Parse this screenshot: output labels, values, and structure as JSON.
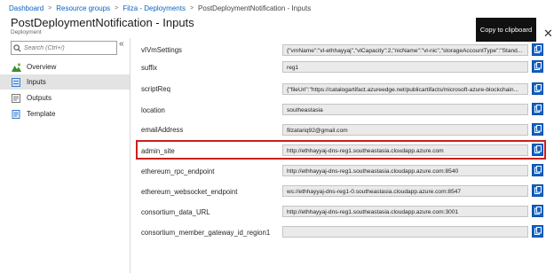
{
  "breadcrumb": [
    "Dashboard",
    "Resource groups",
    "Filza - Deployments",
    "PostDeploymentNotification - Inputs"
  ],
  "breadcrumb_separator": ">",
  "title": "PostDeploymentNotification - Inputs",
  "subtitle": "Deployment",
  "tooltip": "Copy to clipboard",
  "close_glyph": "✕",
  "search": {
    "placeholder": "Search (Ctrl+/)"
  },
  "collapse_glyph": "«",
  "nav": [
    {
      "label": "Overview",
      "icon": "overview-icon"
    },
    {
      "label": "Inputs",
      "icon": "inputs-icon",
      "active": true
    },
    {
      "label": "Outputs",
      "icon": "outputs-icon"
    },
    {
      "label": "Template",
      "icon": "template-icon"
    }
  ],
  "rows": [
    {
      "label": "vIVmSettings",
      "value": "{\"vmName\":\"vl-ethhayyaj\",\"vlCapacity\":2,\"nicName\":\"vl-nic\",\"storageAccountType\":\"Stand..."
    },
    {
      "label": "suffix",
      "value": "reg1"
    },
    {
      "label": "scriptReq",
      "value": "{\"fileUri\":\"https://catalogartifact.azureedge.net/publicartifacts/microsoft-azure-blockchain..."
    },
    {
      "label": "location",
      "value": "southeastasia"
    },
    {
      "label": "emailAddress",
      "value": "filzatariq92@gmail.com"
    },
    {
      "label": "admin_site",
      "value": "http://ethhayyaj-dns-reg1.southeastasia.cloudapp.azure.com"
    },
    {
      "label": "ethereum_rpc_endpoint",
      "value": "http://ethhayyaj-dns-reg1.southeastasia.cloudapp.azure.com:8540"
    },
    {
      "label": "ethereum_websocket_endpoint",
      "value": "ws://ethhayyaj-dns-reg1-0.southeastasia.cloudapp.azure.com:8547"
    },
    {
      "label": "consortium_data_URL",
      "value": "http://ethhayyaj-dns-reg1.southeastasia.cloudapp.azure.com:3001"
    },
    {
      "label": "consortium_member_gateway_id_region1",
      "value": ""
    }
  ],
  "highlighted_row": "admin_site",
  "colors": {
    "accent": "#0e62c8",
    "highlight": "#cc1f1f",
    "link": "#0a62c2"
  }
}
